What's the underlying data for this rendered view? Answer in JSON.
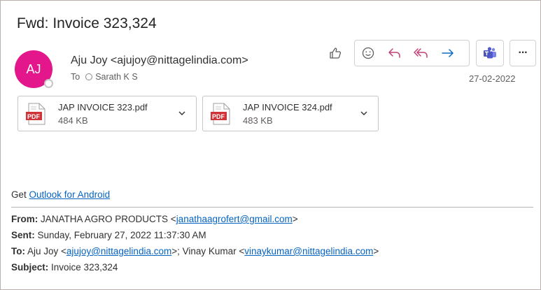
{
  "message": {
    "subject": "Fwd: Invoice 323,324",
    "avatar_initials": "AJ",
    "sender": "Aju Joy <ajujoy@nittagelindia.com>",
    "to_label": "To",
    "to_recipient": "Sarath K S",
    "date": "27-02-2022"
  },
  "toolbar": {
    "icons": [
      "like-icon",
      "emoji-icon",
      "reply-icon",
      "reply-all-icon",
      "forward-icon",
      "teams-icon",
      "more-icon"
    ],
    "more_label": "···"
  },
  "attachments": [
    {
      "name": "JAP INVOICE 323.pdf",
      "size": "484 KB",
      "badge": "PDF"
    },
    {
      "name": "JAP INVOICE 324.pdf",
      "size": "483 KB",
      "badge": "PDF"
    }
  ],
  "body": {
    "get_prefix": "Get",
    "get_link": "Outlook for Android",
    "from_label": "From:",
    "from_name": "JANATHA AGRO PRODUCTS <",
    "from_email": "janathaagrofert@gmail.com",
    "from_close": ">",
    "sent_label": "Sent:",
    "sent_value": "Sunday, February 27, 2022 11:37:30 AM",
    "to_label": "To:",
    "to_name1": "Aju Joy <",
    "to_email1": "ajujoy@nittagelindia.com",
    "to_sep": ">; Vinay Kumar <",
    "to_email2": "vinaykumar@nittagelindia.com",
    "to_close": ">",
    "subject_label": "Subject:",
    "subject_value": "Invoice 323,324"
  },
  "colors": {
    "avatar_bg": "#e3178b",
    "accent": "#0f6cbd",
    "reply_pink": "#c43e78",
    "pdf_red": "#d13438",
    "link": "#0563c1"
  }
}
